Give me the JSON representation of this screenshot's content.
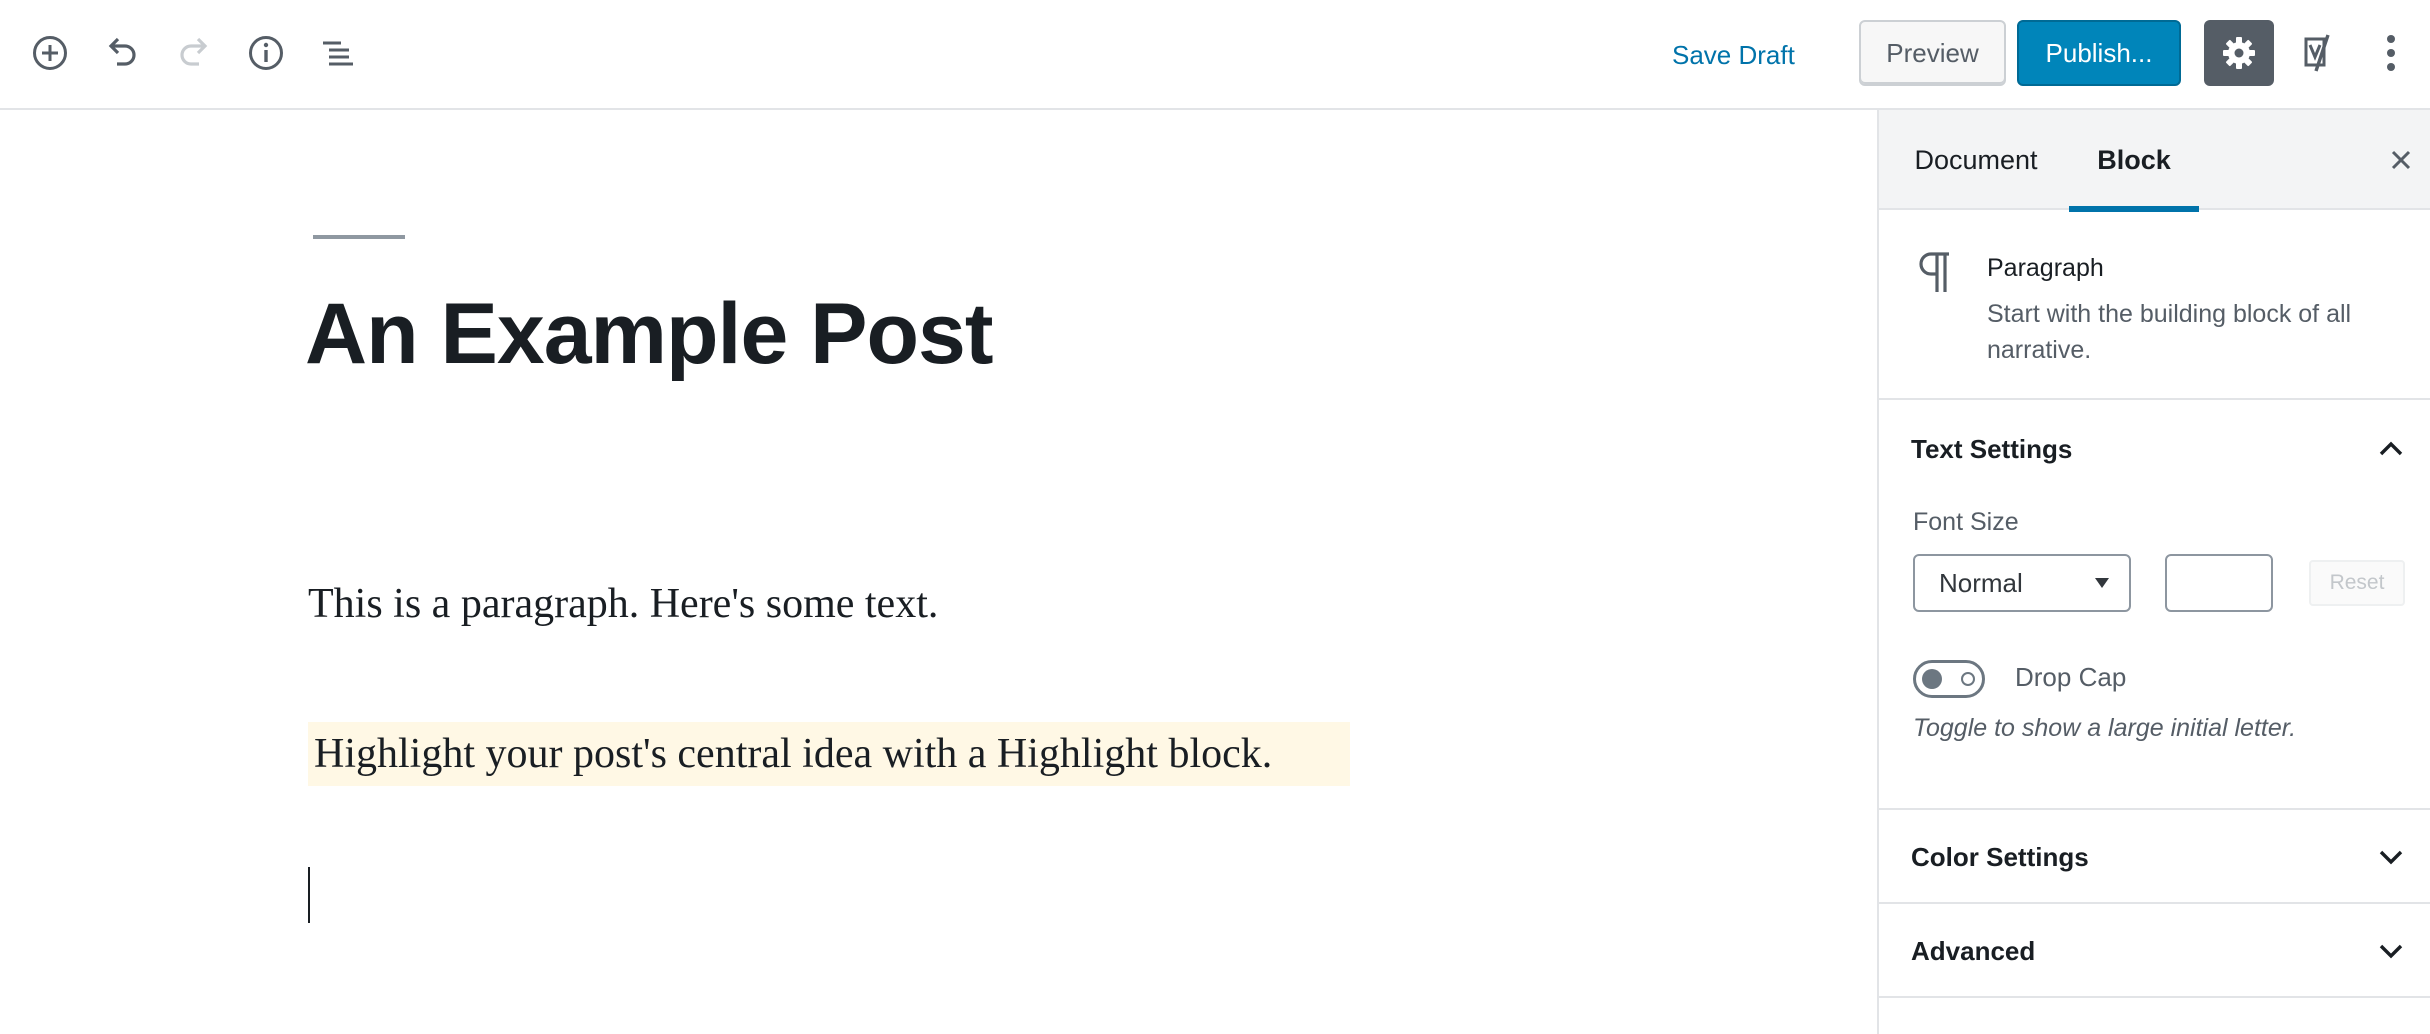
{
  "header": {
    "save_draft": "Save Draft",
    "preview": "Preview",
    "publish": "Publish..."
  },
  "icons": {
    "add": "plus-circle-icon",
    "undo": "undo-icon",
    "redo": "redo-icon",
    "info": "info-icon",
    "outline": "list-outline-icon",
    "settings": "gear-icon",
    "yoast": "yoast-icon",
    "more": "vertical-dots-icon"
  },
  "editor": {
    "title": "An Example Post",
    "paragraph": "This is a paragraph. Here's some text.",
    "highlight": "Highlight your post's central idea with a Highlight block."
  },
  "sidebar": {
    "tabs": [
      "Document",
      "Block"
    ],
    "active_tab": "Block",
    "block_card": {
      "title": "Paragraph",
      "description": "Start with the building block of all narrative."
    },
    "text_settings": {
      "title": "Text Settings",
      "font_size_label": "Font Size",
      "font_size_value": "Normal",
      "custom_size_value": "",
      "reset_label": "Reset",
      "drop_cap_label": "Drop Cap",
      "drop_cap_enabled": false,
      "drop_cap_help": "Toggle to show a large initial letter."
    },
    "color_settings": {
      "title": "Color Settings"
    },
    "advanced": {
      "title": "Advanced"
    }
  },
  "colors": {
    "accent": "#0073aa",
    "publish": "#0085ba",
    "highlight_bg": "#fff8e5",
    "settings_active": "#555d66"
  }
}
